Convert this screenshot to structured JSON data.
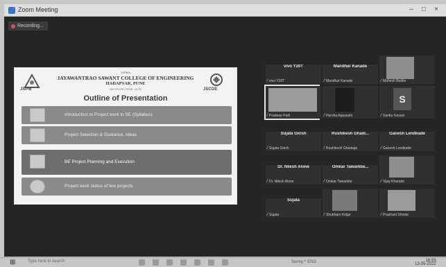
{
  "window": {
    "title": "Zoom Meeting",
    "controls": [
      "–",
      "□",
      "×"
    ]
  },
  "recording": {
    "label": "Recording..."
  },
  "slide": {
    "trust": "JSPM's",
    "college": "JAYAWANTRAO SAWANT COLLEGE OF ENGINEERING",
    "city": "HADAPSAR, PUNE",
    "inst": "INSTITUTE CODE : 6175",
    "logo_left_text": "JSPM",
    "logo_right_text": "JSCOE",
    "heading": "Outline of Presentation",
    "items": [
      "Introduction to Project work in SE (Syllabus)",
      "Project Selection & Guidance, Ideas",
      "BE Project Planning and Execution",
      "Project work status of few projects"
    ]
  },
  "participants": [
    {
      "name": "vivo Y20T",
      "label": "vivo Y20T"
    },
    {
      "name": "Mandhar Kanade",
      "label": "Mandhar Kanade"
    },
    {
      "name": "",
      "label": "Mahesh Bodke"
    },
    {
      "name": "",
      "label": "Pradeep Patil"
    },
    {
      "name": "",
      "label": "Harsha Appasahi"
    },
    {
      "name": "",
      "label": "Sarika Gosavi",
      "letter": "S"
    },
    {
      "name": "Sujata Girish",
      "label": "Sujata Girish"
    },
    {
      "name": "Rushikesh Ghadi...",
      "label": "Rushikesh Ghadage"
    },
    {
      "name": "Ganesh Lendkade",
      "label": "Ganesh Lendkade"
    },
    {
      "name": "Dr. Nilesh Alone",
      "label": "Dr. Nilesh Alone"
    },
    {
      "name": "Omkar Tawambe...",
      "label": "Omkar Tawambe"
    },
    {
      "name": "",
      "label": "Vijay Kharade"
    },
    {
      "name": "Sujata",
      "label": "Sujata"
    },
    {
      "name": "",
      "label": "Shubham Kolge"
    },
    {
      "name": "",
      "label": "Prashant Shinde"
    }
  ],
  "taskbar": {
    "search": "Type here to search",
    "tray": "Sunny   ^ ENG",
    "time": "16:55",
    "date": "13-05-2022"
  },
  "colors": {
    "accent": "#3a73c8",
    "record": "#d9534f"
  }
}
